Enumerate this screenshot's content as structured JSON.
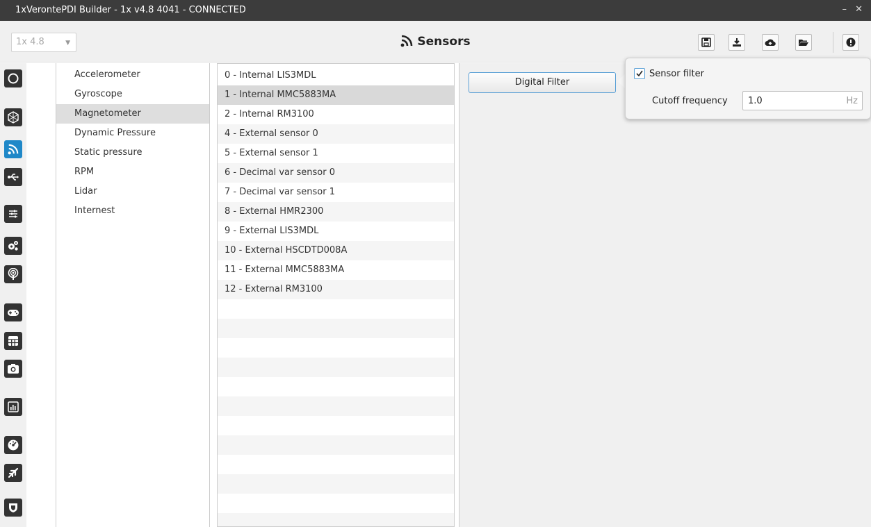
{
  "window": {
    "title": "1xVerontePDI Builder - 1x v4.8 4041 - CONNECTED",
    "minimize": "–",
    "close": "✕"
  },
  "header": {
    "version_value": "1x 4.8",
    "title": "Sensors"
  },
  "toolbar": [
    {
      "icon": "save-icon"
    },
    {
      "icon": "download-icon"
    },
    {
      "icon": "cloud-upload-icon"
    },
    {
      "icon": "folder-open-icon"
    },
    {
      "icon": "info-icon"
    }
  ],
  "sidebar": {
    "icons": [
      "power-icon",
      "hexagon-net-icon",
      "rss-icon",
      "usb-icon",
      "sliders-icon",
      "gears-icon",
      "podcast-icon",
      "gamepad-icon",
      "grid-icon",
      "camera-icon",
      "chart-icon",
      "gauge-icon",
      "plane-icon",
      "shield-icon"
    ],
    "active_index": 2
  },
  "categories": {
    "items": [
      "Accelerometer",
      "Gyroscope",
      "Magnetometer",
      "Dynamic Pressure",
      "Static pressure",
      "RPM",
      "Lidar",
      "Internest"
    ],
    "selected_index": 2
  },
  "sensors": {
    "items": [
      "0 - Internal LIS3MDL",
      "1 - Internal MMC5883MA",
      "2 - Internal RM3100",
      "4 - External sensor 0",
      "5 - External sensor 1",
      "6 - Decimal var sensor 0",
      "7 - Decimal var sensor 1",
      "8 - External HMR2300",
      "9 - External LIS3MDL",
      "10 - External HSCDTD008A",
      "11 - External MMC5883MA",
      "12 - External RM3100"
    ],
    "selected_index": 1
  },
  "detail": {
    "digital_filter_label": "Digital Filter",
    "sensor_filter_label": "Sensor filter",
    "sensor_filter_checked": true,
    "cutoff_label": "Cutoff frequency",
    "cutoff_value": "1.0",
    "cutoff_unit": "Hz"
  },
  "colors": {
    "accent": "#1f88c8",
    "titlebar": "#3c3c3c",
    "icon_bg": "#333333"
  }
}
